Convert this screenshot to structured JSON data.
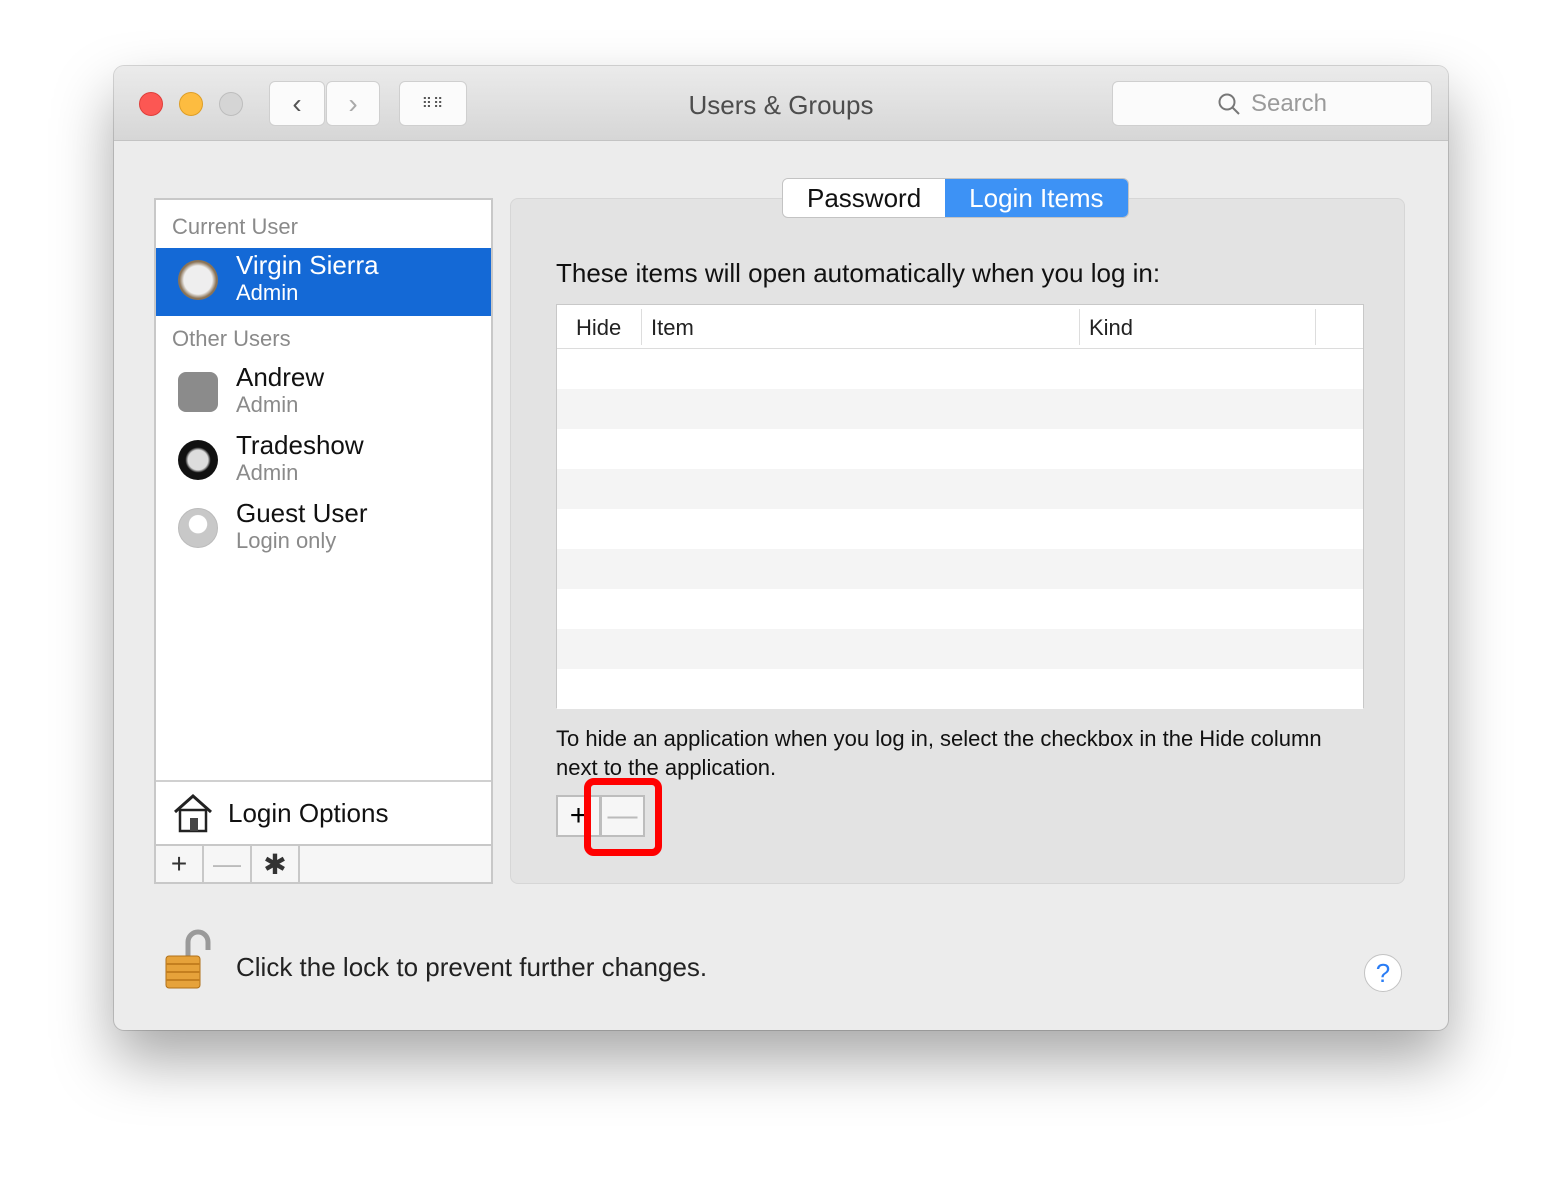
{
  "window": {
    "title": "Users & Groups",
    "search_placeholder": "Search"
  },
  "sidebar": {
    "current_user_label": "Current User",
    "other_users_label": "Other Users",
    "current": {
      "name": "Virgin Sierra",
      "role": "Admin"
    },
    "others": [
      {
        "name": "Andrew",
        "role": "Admin"
      },
      {
        "name": "Tradeshow",
        "role": "Admin"
      },
      {
        "name": "Guest User",
        "role": "Login only"
      }
    ],
    "login_options": "Login Options"
  },
  "tabs": [
    {
      "label": "Password",
      "active": false
    },
    {
      "label": "Login Items",
      "active": true
    }
  ],
  "main": {
    "description": "These items will open automatically when you log in:",
    "columns": [
      "Hide",
      "Item",
      "Kind"
    ],
    "hint": "To hide an application when you log in, select the checkbox in the Hide column next to the application."
  },
  "footer": {
    "lock_text": "Click the lock to prevent further changes.",
    "help": "?"
  },
  "colors": {
    "selection": "#1469d6",
    "tab_active": "#3d92f5",
    "highlight": "#ff0000"
  }
}
